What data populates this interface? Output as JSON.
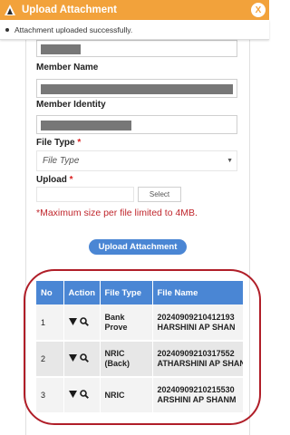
{
  "window": {
    "title": "Upload Attachment",
    "close_label": "X"
  },
  "toast": {
    "message": "Attachment uploaded successfully."
  },
  "form": {
    "member_name_label": "Member Name",
    "member_identity_label": "Member Identity",
    "file_type_label": "File Type",
    "file_type_required": "*",
    "file_type_placeholder": "File Type",
    "upload_label": "Upload",
    "upload_required": "*",
    "select_button": "Select",
    "size_note": "*Maximum size per file limited to 4MB.",
    "upload_button": "Upload Attachment"
  },
  "table": {
    "columns": [
      "No",
      "Action",
      "File Type",
      "File Name"
    ],
    "rows": [
      {
        "no": "1",
        "type_line1": "Bank",
        "type_line2": "Prove",
        "name_line1": "20240909210412193",
        "name_line2": "HARSHINI AP SHAN"
      },
      {
        "no": "2",
        "type_line1": "NRIC",
        "type_line2": "(Back)",
        "name_line1": "20240909210317552",
        "name_line2": "ATHARSHINI AP SHAN"
      },
      {
        "no": "3",
        "type_line1": "NRIC",
        "type_line2": "",
        "name_line1": "20240909210215530",
        "name_line2": "ARSHINI AP SHANM"
      }
    ]
  },
  "colors": {
    "titlebar": "#f2a23b",
    "accent": "#4a86d4",
    "warning_text": "#c0272d",
    "highlight": "#b01e28"
  },
  "icons": {
    "logo": "app-logo-icon",
    "close": "close-icon",
    "download": "download-icon",
    "view": "search-icon"
  }
}
